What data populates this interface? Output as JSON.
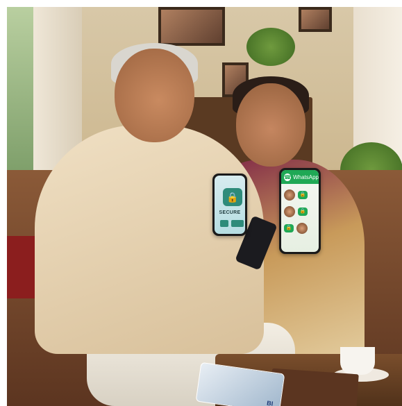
{
  "overlay": {
    "secure_phone": {
      "label": "SECURE",
      "lock_icon": "lock-icon"
    },
    "whatsapp_phone": {
      "app_label": "WhatsApp",
      "logo_icon": "whatsapp-logo-icon"
    }
  },
  "bank_card": {
    "text": "BI"
  },
  "colors": {
    "whatsapp_green": "#1fa855",
    "secure_teal": "#2e8b7a"
  }
}
